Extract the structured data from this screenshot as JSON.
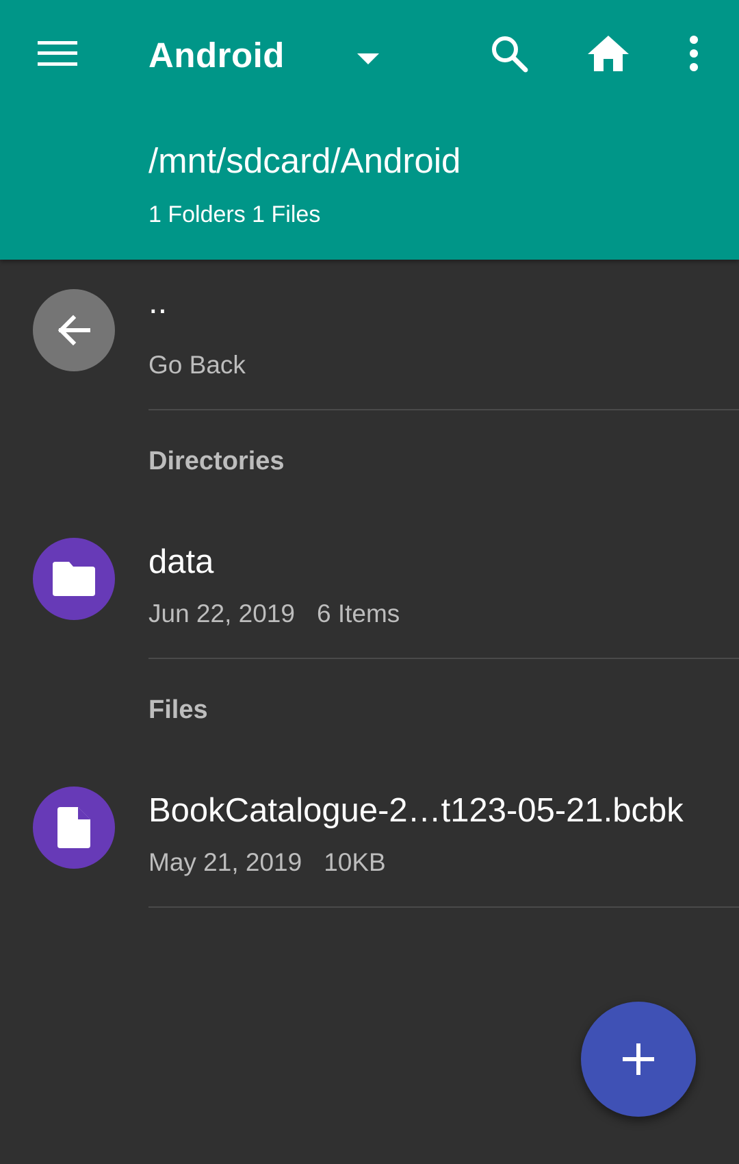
{
  "colors": {
    "appbar": "#009688",
    "background": "#303030",
    "avatar_back": "#757575",
    "avatar_item": "#673ab7",
    "fab": "#3f51b5"
  },
  "appbar": {
    "menu_icon": "hamburger-menu-icon",
    "title": "Android",
    "dropdown_icon": "caret-down-icon",
    "search_icon": "search-icon",
    "home_icon": "home-icon",
    "more_icon": "more-vert-icon",
    "path": "/mnt/sdcard/Android",
    "summary": "1 Folders 1 Files"
  },
  "go_back": {
    "icon": "arrow-back-icon",
    "title": "..",
    "subtitle": "Go Back"
  },
  "sections": {
    "directories": "Directories",
    "files": "Files"
  },
  "directories": [
    {
      "icon": "folder-icon",
      "name": "data",
      "date": "Jun 22, 2019",
      "info": "6 Items"
    }
  ],
  "files": [
    {
      "icon": "file-icon",
      "name": "BookCatalogue-2…t123-05-21.bcbk",
      "date": "May 21, 2019",
      "info": "10KB"
    }
  ],
  "fab": {
    "icon": "plus-icon"
  }
}
